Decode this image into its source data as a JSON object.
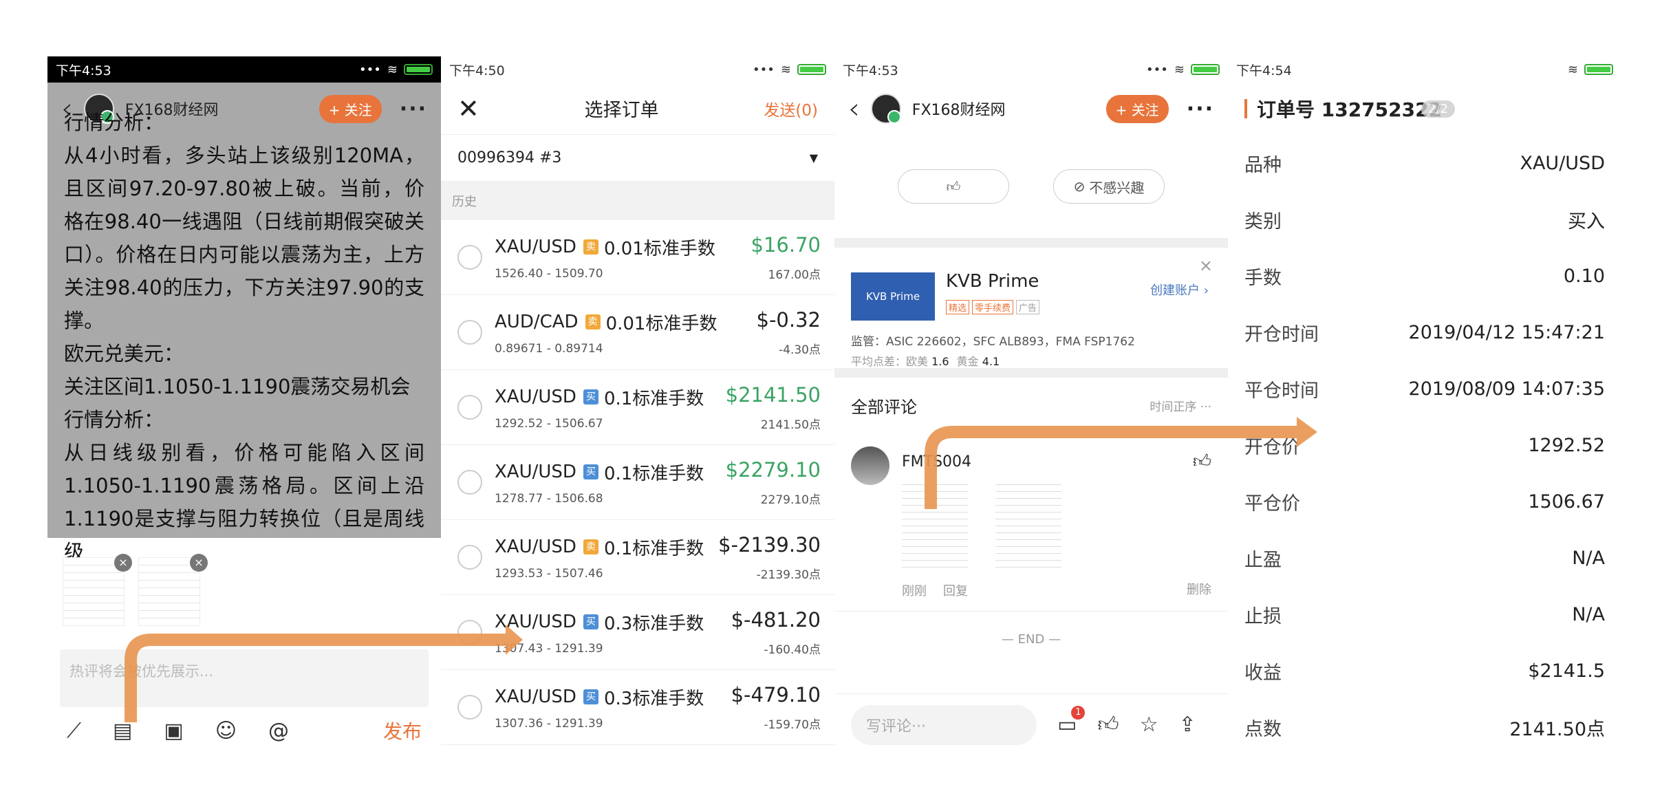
{
  "panel1": {
    "status": {
      "time": "下午4:53"
    },
    "header": {
      "name": "FX168财经网",
      "follow": "+ 关注"
    },
    "article": {
      "lines": [
        "行情分析：",
        "从4小时看，多头站上该级别120MA，且区间97.20-97.80被上破。当前，价格在98.40一线遇阻（日线前期假突破关口）。价格在日内可能以震荡为主，上方关注98.40的压力，下方关注97.90的支撑。",
        "欧元兑美元：",
        "关注区间1.1050-1.1190震荡交易机会",
        "行情分析：",
        "从日线级别看，价格可能陷入区间1.1050-1.1190震荡格局。区间上沿1.1190是支撑与阻力转换位（且是周线级"
      ]
    },
    "comment_placeholder": "热评将会被优先展示...",
    "publish": "发布"
  },
  "panel2": {
    "status": {
      "time": "下午4:50"
    },
    "title": "选择订单",
    "send": "发送(0)",
    "account": "00996394 #3",
    "history_label": "历史",
    "orders": [
      {
        "symbol": "XAU/USD",
        "side": "卖",
        "side_type": "sell",
        "lots": "0.01标准手数",
        "range": "1526.40 - 1509.70",
        "amount": "$16.70",
        "positive": true,
        "points": "167.00点"
      },
      {
        "symbol": "AUD/CAD",
        "side": "卖",
        "side_type": "sell",
        "lots": "0.01标准手数",
        "range": "0.89671 - 0.89714",
        "amount": "$-0.32",
        "positive": false,
        "points": "-4.30点"
      },
      {
        "symbol": "XAU/USD",
        "side": "买",
        "side_type": "buy",
        "lots": "0.1标准手数",
        "range": "1292.52 - 1506.67",
        "amount": "$2141.50",
        "positive": true,
        "points": "2141.50点"
      },
      {
        "symbol": "XAU/USD",
        "side": "买",
        "side_type": "buy",
        "lots": "0.1标准手数",
        "range": "1278.77 - 1506.68",
        "amount": "$2279.10",
        "positive": true,
        "points": "2279.10点"
      },
      {
        "symbol": "XAU/USD",
        "side": "卖",
        "side_type": "sell",
        "lots": "0.1标准手数",
        "range": "1293.53 - 1507.46",
        "amount": "$-2139.30",
        "positive": false,
        "points": "-2139.30点"
      },
      {
        "symbol": "XAU/USD",
        "side": "买",
        "side_type": "buy",
        "lots": "0.3标准手数",
        "range": "1307.43 - 1291.39",
        "amount": "$-481.20",
        "positive": false,
        "points": "-160.40点"
      },
      {
        "symbol": "XAU/USD",
        "side": "买",
        "side_type": "buy",
        "lots": "0.3标准手数",
        "range": "1307.36 - 1291.39",
        "amount": "$-479.10",
        "positive": false,
        "points": "-159.70点"
      }
    ]
  },
  "panel3": {
    "status": {
      "time": "下午4:53"
    },
    "header": {
      "name": "FX168财经网",
      "follow": "+ 关注"
    },
    "not_interested": "不感兴趣",
    "ad": {
      "logo": "KVB Prime",
      "name": "KVB Prime",
      "tags": [
        "精选",
        "零手续费",
        "广告"
      ],
      "cta": "创建账户",
      "regulation": "监管：ASIC 226602，SFC ALB893，FMA FSP1762",
      "spread_label": "平均点差：",
      "spread_eur_label": "欧美",
      "spread_eur": "1.6",
      "spread_gold_label": "黄金",
      "spread_gold": "4.1"
    },
    "comments_title": "全部评论",
    "sort": "时间正序",
    "comment": {
      "user": "FMTS004",
      "time": "刚刚",
      "reply": "回复",
      "delete": "删除"
    },
    "end": "— END —",
    "write_placeholder": "写评论···",
    "badge": "1"
  },
  "panel4": {
    "status": {
      "time": "下午4:54"
    },
    "title": "订单号 132752322",
    "page": "2/2",
    "rows": [
      {
        "k": "品种",
        "v": "XAU/USD"
      },
      {
        "k": "类别",
        "v": "买入"
      },
      {
        "k": "手数",
        "v": "0.10"
      },
      {
        "k": "开仓时间",
        "v": "2019/04/12 15:47:21"
      },
      {
        "k": "平仓时间",
        "v": "2019/08/09 14:07:35"
      },
      {
        "k": "开仓价",
        "v": "1292.52"
      },
      {
        "k": "平仓价",
        "v": "1506.67"
      },
      {
        "k": "止盈",
        "v": "N/A"
      },
      {
        "k": "止损",
        "v": "N/A"
      },
      {
        "k": "收益",
        "v": "$2141.5"
      },
      {
        "k": "点数",
        "v": "2141.50点"
      }
    ]
  },
  "colors": {
    "accent": "#e8743b",
    "positive": "#3aa464",
    "buy_tag": "#4d8fd6",
    "sell_tag": "#f0a93a"
  }
}
